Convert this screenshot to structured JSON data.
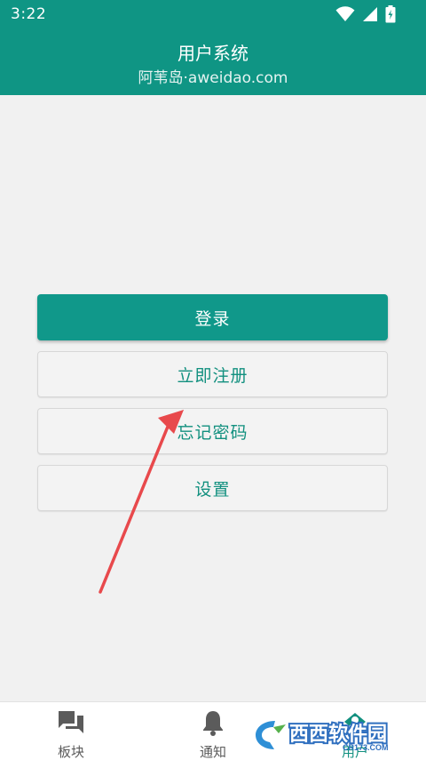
{
  "status_bar": {
    "time": "3:22"
  },
  "header": {
    "title": "用户系统",
    "subtitle": "阿苇岛·aweidao.com"
  },
  "actions": {
    "login_label": "登录",
    "register_label": "立即注册",
    "forgot_password_label": "忘记密码",
    "settings_label": "设置"
  },
  "bottom_nav": {
    "items": [
      {
        "label": "板块",
        "icon": "forum-icon"
      },
      {
        "label": "通知",
        "icon": "bell-icon"
      },
      {
        "label": "用户",
        "icon": "user-icon",
        "active": true
      }
    ]
  },
  "colors": {
    "primary": "#0f9584",
    "accent_text": "#12907f",
    "background": "#f1f1f1",
    "annotation_arrow": "#e8494c"
  },
  "watermark": {
    "brand": "西西软件园",
    "site": "CR173.COM"
  }
}
